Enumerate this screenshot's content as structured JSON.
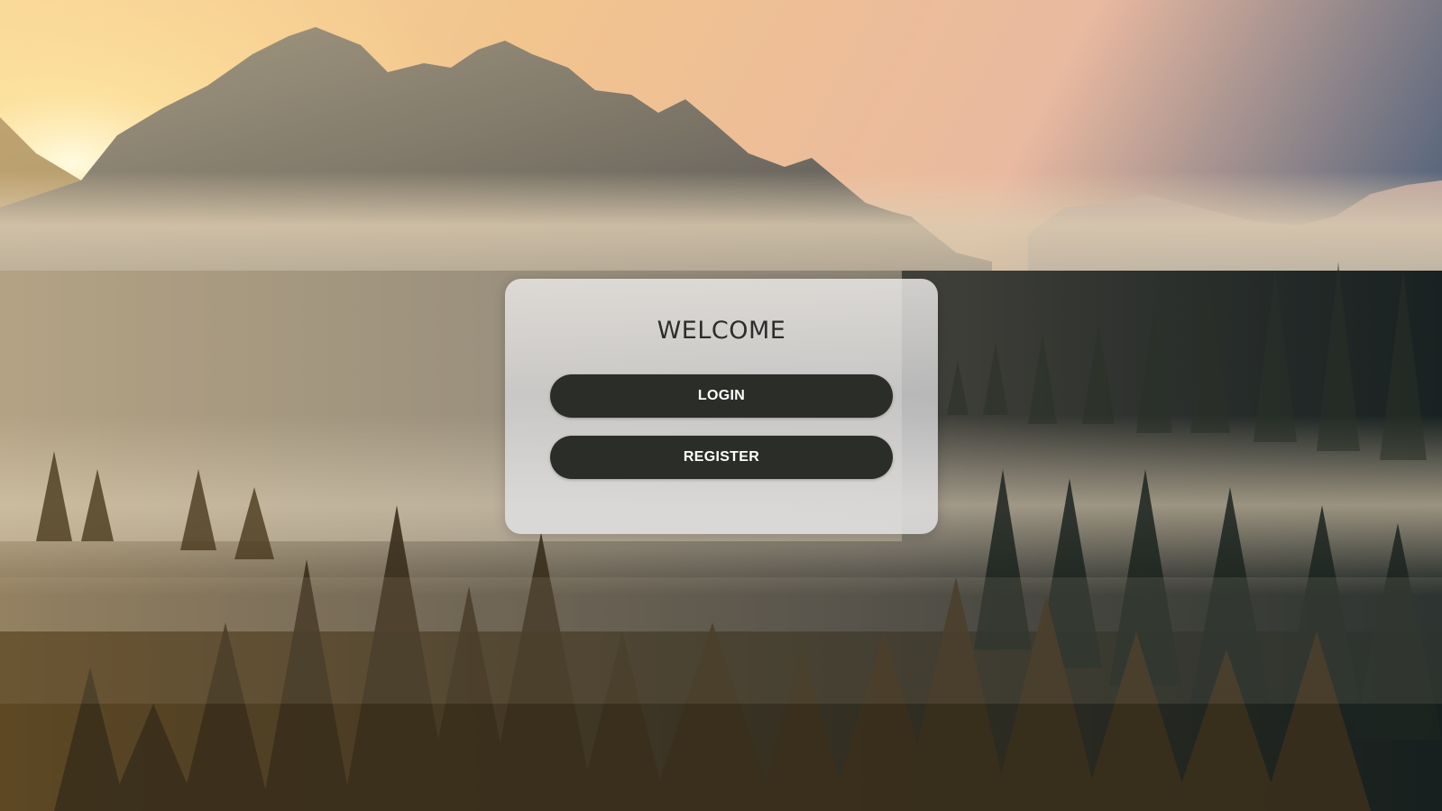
{
  "welcome_card": {
    "title": "WELCOME",
    "login_label": "LOGIN",
    "register_label": "REGISTER"
  },
  "background": {
    "description_icon": "mountain-forest-fog-landscape",
    "colors": {
      "sky_warm": "#f3c98d",
      "sky_cool": "#5b6e86",
      "sun": "#fff3c2",
      "mountain": "#8e8676",
      "fog": "#d9cbb0",
      "forest_dark": "#1f2a26",
      "forest_gold": "#7a5a2a"
    }
  },
  "button_color": "#2b2d29"
}
